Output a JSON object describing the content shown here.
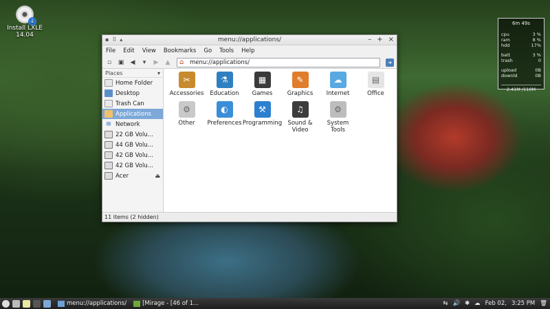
{
  "desktop": {
    "install_label": "Install LXLE\n14.04"
  },
  "conky": {
    "uptime": "6m 49s",
    "rows1": [
      [
        "cpu",
        "3 %"
      ],
      [
        "ram",
        "8 %"
      ],
      [
        "hdd",
        "17%"
      ]
    ],
    "rows2": [
      [
        "batt",
        "3 %"
      ],
      [
        "trash",
        "0"
      ]
    ],
    "rows3": [
      [
        "upload",
        "0B"
      ],
      [
        "downld",
        "0B"
      ]
    ],
    "memory": "2.41M /110M"
  },
  "window": {
    "title": "menu://applications/",
    "menu": [
      "File",
      "Edit",
      "View",
      "Bookmarks",
      "Go",
      "Tools",
      "Help"
    ],
    "address": "menu://applications/",
    "sidebar_header": "Places",
    "places": [
      {
        "label": "Home Folder",
        "icon": "home-folder-icon",
        "cls": "home"
      },
      {
        "label": "Desktop",
        "icon": "desktop-icon",
        "cls": "desk"
      },
      {
        "label": "Trash Can",
        "icon": "trash-icon",
        "cls": "trash"
      },
      {
        "label": "Applications",
        "icon": "applications-icon",
        "cls": "apps",
        "active": true
      },
      {
        "label": "Network",
        "icon": "network-icon",
        "cls": "net"
      },
      {
        "label": "22 GB Volu...",
        "icon": "drive-icon",
        "cls": "drive"
      },
      {
        "label": "44 GB Volu...",
        "icon": "drive-icon",
        "cls": "drive"
      },
      {
        "label": "42 GB Volu...",
        "icon": "drive-icon",
        "cls": "drive"
      },
      {
        "label": "42 GB Volu...",
        "icon": "drive-icon",
        "cls": "drive"
      },
      {
        "label": "Acer",
        "icon": "drive-icon",
        "cls": "drive",
        "eject": true
      }
    ],
    "apps": [
      {
        "label": "Accessories",
        "icon": "accessories-icon",
        "color": "#c88a2e",
        "glyph": "✂"
      },
      {
        "label": "Education",
        "icon": "education-icon",
        "color": "#2f7fc1",
        "glyph": "⚗"
      },
      {
        "label": "Games",
        "icon": "games-icon",
        "color": "#3a3a3a",
        "glyph": "▦"
      },
      {
        "label": "Graphics",
        "icon": "graphics-icon",
        "color": "#e07d2a",
        "glyph": "✎"
      },
      {
        "label": "Internet",
        "icon": "internet-icon",
        "color": "#58a9e0",
        "glyph": "☁"
      },
      {
        "label": "Office",
        "icon": "office-icon",
        "color": "#e5e5e5",
        "glyph": "▤"
      },
      {
        "label": "Other",
        "icon": "other-icon",
        "color": "#c9c9c9",
        "glyph": "⚙"
      },
      {
        "label": "Preferences",
        "icon": "preferences-icon",
        "color": "#3b8fd8",
        "glyph": "◐"
      },
      {
        "label": "Programming",
        "icon": "programming-icon",
        "color": "#2d7fd0",
        "glyph": "⚒"
      },
      {
        "label": "Sound &\nVideo",
        "icon": "sound-video-icon",
        "color": "#3c3c3c",
        "glyph": "♫"
      },
      {
        "label": "System Tools",
        "icon": "system-tools-icon",
        "color": "#bdbdbd",
        "glyph": "⚙"
      }
    ],
    "status": "11 items (2 hidden)"
  },
  "taskbar": {
    "tasks": [
      {
        "label": "menu://applications/",
        "icon": "folder-icon"
      },
      {
        "label": "[Mirage - [46 of 1...",
        "icon": "mirage-icon"
      }
    ],
    "date": "Feb 02,",
    "time": "3:25 PM"
  }
}
